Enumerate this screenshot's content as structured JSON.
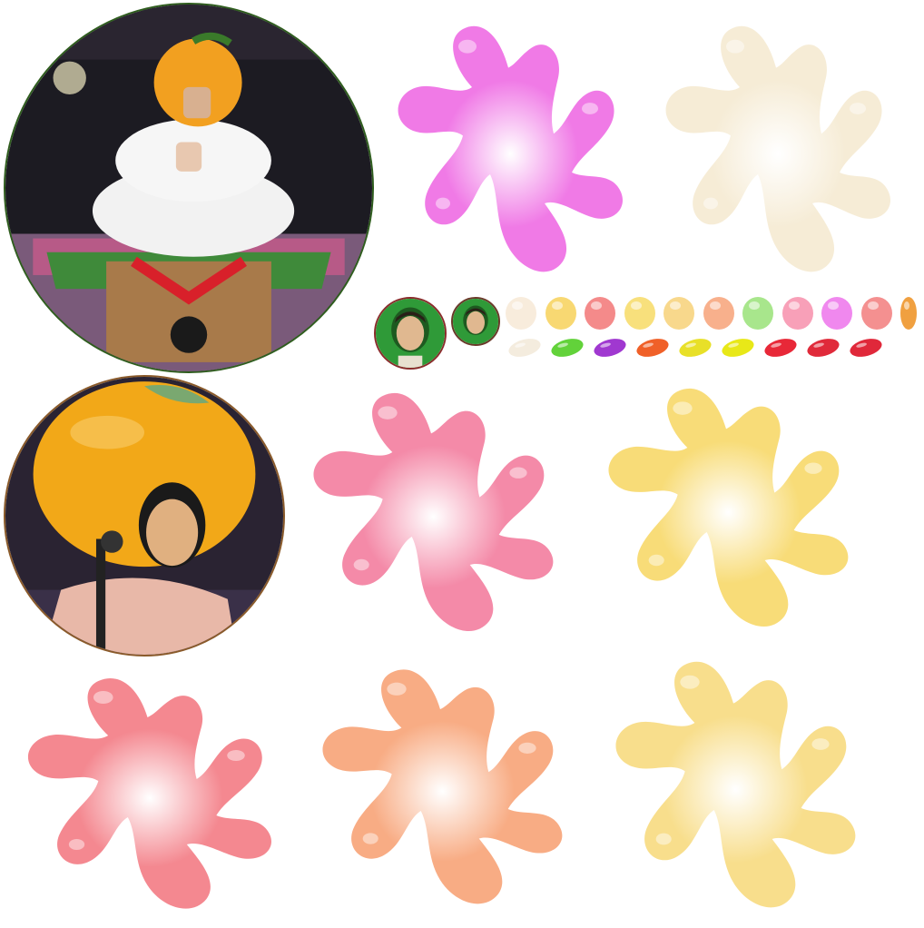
{
  "sheet": {
    "photos": [
      {
        "name": "photo-kagami-mochi-costume",
        "icon": "performer-in-kagami-mochi-costume",
        "ring": "#2f5d1e",
        "bg": "#1c1b22"
      },
      {
        "name": "photo-orange-head-costume",
        "icon": "performer-in-orange-head-costume",
        "ring": "#8a5a2a",
        "bg": "#2a2332"
      },
      {
        "name": "avatar-green-frame-large",
        "icon": "face-avatar",
        "ring": "#8a2c2c",
        "bg": "#2f9a38"
      },
      {
        "name": "avatar-green-frame-small",
        "icon": "face-avatar",
        "ring": "#6a3a2a",
        "bg": "#2f9a38"
      }
    ],
    "splats": [
      {
        "name": "splat-magenta",
        "color": "#f07ae6"
      },
      {
        "name": "splat-cream-faded",
        "color": "#f6ecd6"
      },
      {
        "name": "splat-pink",
        "color": "#f48aa8"
      },
      {
        "name": "splat-yellow",
        "color": "#f8dc78"
      },
      {
        "name": "splat-salmon",
        "color": "#f48890"
      },
      {
        "name": "splat-peach",
        "color": "#f8ac84"
      },
      {
        "name": "splat-light-yellow",
        "color": "#f8de8c"
      }
    ],
    "dots": [
      "#f8ecdc",
      "#f8d872",
      "#f48a8a",
      "#f8e07c",
      "#f8d88c",
      "#f8b08c",
      "#a8e68c",
      "#f8a0b8",
      "#f088ee",
      "#f49090",
      "#f0a040"
    ],
    "beans": [
      "#f4ecde",
      "#62d23a",
      "#a038d0",
      "#f06028",
      "#e8e028",
      "#e8e818",
      "#e82838",
      "#e02a3a",
      "#e0283a"
    ]
  }
}
